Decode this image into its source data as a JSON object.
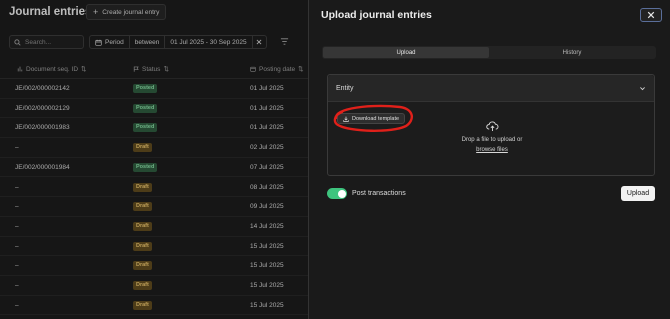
{
  "page": {
    "title": "Journal entries",
    "create_label": "Create journal entry",
    "search_placeholder": "Search...",
    "filter": {
      "field": "Period",
      "operator": "between",
      "value": "01 Jul 2025 - 30 Sep 2025"
    },
    "columns": {
      "doc_seq": "Document seq. ID",
      "status": "Status",
      "posting_date": "Posting date"
    },
    "rows": [
      {
        "doc": "JE/002/000002142",
        "status": "Posted",
        "date": "01 Jul 2025"
      },
      {
        "doc": "JE/002/000002129",
        "status": "Posted",
        "date": "01 Jul 2025"
      },
      {
        "doc": "JE/002/000001983",
        "status": "Posted",
        "date": "01 Jul 2025"
      },
      {
        "doc": "–",
        "status": "Draft",
        "date": "02 Jul 2025"
      },
      {
        "doc": "JE/002/000001984",
        "status": "Posted",
        "date": "07 Jul 2025"
      },
      {
        "doc": "–",
        "status": "Draft",
        "date": "08 Jul 2025"
      },
      {
        "doc": "–",
        "status": "Draft",
        "date": "09 Jul 2025"
      },
      {
        "doc": "–",
        "status": "Draft",
        "date": "14 Jul 2025"
      },
      {
        "doc": "–",
        "status": "Draft",
        "date": "15 Jul 2025"
      },
      {
        "doc": "–",
        "status": "Draft",
        "date": "15 Jul 2025"
      },
      {
        "doc": "–",
        "status": "Draft",
        "date": "15 Jul 2025"
      },
      {
        "doc": "–",
        "status": "Draft",
        "date": "15 Jul 2025"
      }
    ],
    "colors": {
      "posted_bg": "#2e5a3e",
      "posted_text": "#86d8a2",
      "draft_bg": "#5e4a1e",
      "draft_text": "#e6c06c"
    }
  },
  "drawer": {
    "title": "Upload journal entries",
    "tabs": {
      "upload": "Upload",
      "history": "History"
    },
    "active_tab": "Upload",
    "entity_label": "Entity",
    "download_template_label": "Download template",
    "drop_text": "Drop a file to upload or",
    "browse_label": "browse files",
    "post_transactions_label": "Post transactions",
    "post_transactions_enabled": true,
    "upload_label": "Upload",
    "colors": {
      "toggle_on": "#3ec47e",
      "annotation_red": "#e0201a"
    }
  }
}
